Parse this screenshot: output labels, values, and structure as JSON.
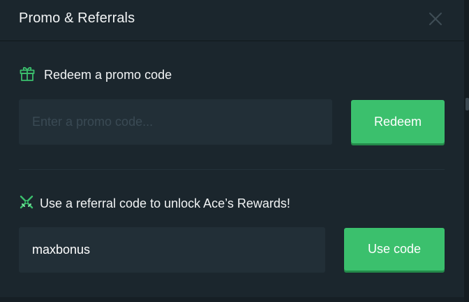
{
  "modal": {
    "title": "Promo & Referrals"
  },
  "promo": {
    "label": "Redeem a promo code",
    "icon": "gift-icon",
    "placeholder": "Enter a promo code...",
    "button_label": "Redeem"
  },
  "referral": {
    "label": "Use a referral code to unlock Ace’s Rewards!",
    "icon": "crossed-swords-icon",
    "value": "maxbonus",
    "button_label": "Use code"
  },
  "colors": {
    "accent": "#3bc06d",
    "background": "#1b262d",
    "input_bg": "#222f37"
  }
}
